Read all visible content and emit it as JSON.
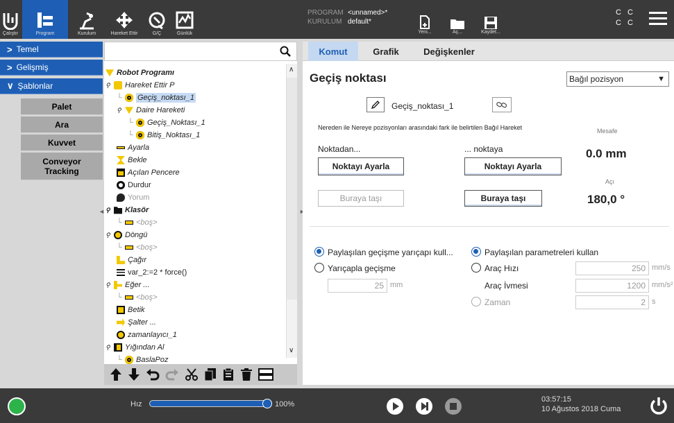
{
  "topbar": {
    "buttons": [
      {
        "label": "Çalıştır"
      },
      {
        "label": "Program"
      },
      {
        "label": "Kurulum"
      },
      {
        "label": "Hareket Ettir"
      },
      {
        "label": "G/Ç"
      },
      {
        "label": "Günlük"
      }
    ],
    "program_key": "PROGRAM",
    "program_value": "<unnamed>*",
    "installation_key": "KURULUM",
    "installation_value": "default*",
    "file_buttons": [
      {
        "label": "Yeni..."
      },
      {
        "label": "Aç..."
      },
      {
        "label": "Kaydet..."
      }
    ],
    "status_line1": "C C",
    "status_line2": "C C"
  },
  "leftnav": {
    "basic": "Temel",
    "advanced": "Gelişmiş",
    "templates": "Şablonlar",
    "template_items": [
      "Palet",
      "Ara",
      "Kuvvet",
      "Conveyor Tracking"
    ]
  },
  "tree": {
    "nodes": [
      {
        "label": "Robot Programı"
      },
      {
        "label": "Hareket Ettir P"
      },
      {
        "label": "Geçiş_noktası_1"
      },
      {
        "label": "Daire Hareketi"
      },
      {
        "label": "Geçiş_Noktası_1"
      },
      {
        "label": "Bitiş_Noktası_1"
      },
      {
        "label": "Ayarla"
      },
      {
        "label": "Bekle"
      },
      {
        "label": "Açılan Pencere"
      },
      {
        "label": "Durdur"
      },
      {
        "label": "Yorum"
      },
      {
        "label": "Klasör"
      },
      {
        "label": "<boş>"
      },
      {
        "label": "Döngü"
      },
      {
        "label": "<boş>"
      },
      {
        "label": "Çağır"
      },
      {
        "label": "var_2:=2 * force()"
      },
      {
        "label": "Eğer ..."
      },
      {
        "label": "<boş>"
      },
      {
        "label": "Betik"
      },
      {
        "label": "Şalter ..."
      },
      {
        "label": "zamanlayıcı_1"
      },
      {
        "label": "Yığından Al"
      },
      {
        "label": "BaslaPoz"
      }
    ]
  },
  "right": {
    "tabs": [
      "Komut",
      "Grafik",
      "Değişkenler"
    ],
    "title": "Geçiş noktası",
    "position_type": "Bağıl pozisyon",
    "waypoint_name": "Geçiş_noktası_1",
    "description": "Nereden ile Nereye pozisyonları arasındaki fark ile belirtilen Bağıl Hareket",
    "distance_label": "Mesafe",
    "distance_value": "0.0 mm",
    "angle_label": "Açı",
    "angle_value": "180,0 °",
    "from_label": "Noktadan...",
    "to_label": "... noktaya",
    "set_point_from": "Noktayı Ayarla",
    "set_point_to": "Noktayı Ayarla",
    "move_here_from": "Buraya taşı",
    "move_here_to": "Buraya taşı",
    "blend_shared": "Paylaşılan geçişme yarıçapı kull...",
    "blend_radius": "Yarıçapla geçişme",
    "blend_value": "25",
    "blend_unit": "mm",
    "param_shared": "Paylaşılan parametreleri kullan",
    "tool_speed": "Araç Hızı",
    "tool_speed_value": "250",
    "tool_speed_unit": "mm/s",
    "tool_accel": "Araç İvmesi",
    "tool_accel_value": "1200",
    "tool_accel_unit": "mm/s²",
    "time": "Zaman",
    "time_value": "2",
    "time_unit": "s"
  },
  "bottombar": {
    "speed_label": "Hız",
    "speed_value": "100%",
    "speed_fraction": 1.0,
    "time": "03:57:15",
    "date": "10 Ağustos 2018 Cuma"
  }
}
